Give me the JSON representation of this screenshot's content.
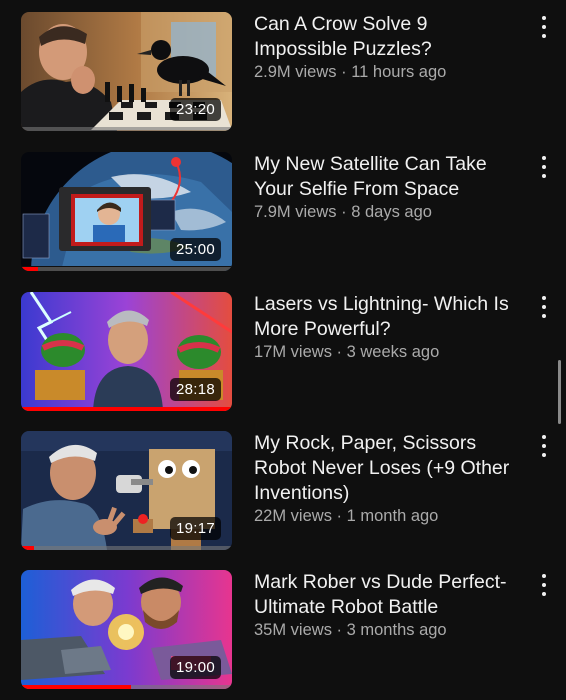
{
  "videos": [
    {
      "title": "Can A Crow Solve 9 Impossible Puzzles?",
      "views": "2.9M views",
      "age": "11 hours ago",
      "duration": "23:20",
      "watched_fraction": 0.0,
      "thumbnail": "man-chess-crow"
    },
    {
      "title": "My New Satellite Can Take Your Selfie From Space",
      "views": "7.9M views",
      "age": "8 days ago",
      "duration": "25:00",
      "watched_fraction": 0.08,
      "thumbnail": "satellite-earth-selfie"
    },
    {
      "title": "Lasers vs Lightning- Which Is More Powerful?",
      "views": "17M views",
      "age": "3 weeks ago",
      "duration": "28:18",
      "watched_fraction": 1.0,
      "thumbnail": "lasers-lightning-watermelons"
    },
    {
      "title": "My Rock, Paper, Scissors Robot Never Loses (+9 Other Inventions)",
      "views": "22M views",
      "age": "1 month ago",
      "duration": "19:17",
      "watched_fraction": 0.06,
      "thumbnail": "rock-paper-scissors-robot"
    },
    {
      "title": "Mark Rober vs Dude Perfect- Ultimate Robot Battle",
      "views": "35M views",
      "age": "3 months ago",
      "duration": "19:00",
      "watched_fraction": 0.52,
      "thumbnail": "robot-battle"
    }
  ],
  "separator": " · "
}
